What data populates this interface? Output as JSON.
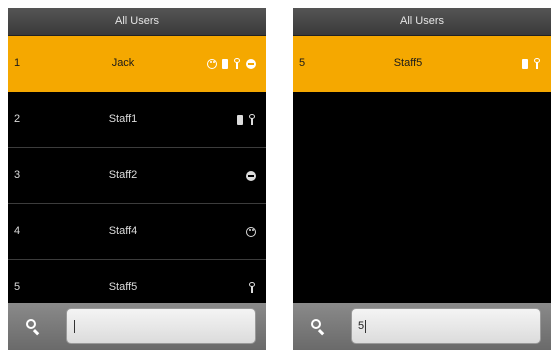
{
  "left": {
    "title": "All Users",
    "users": [
      {
        "num": "1",
        "name": "Jack",
        "icons": [
          "face",
          "card",
          "key",
          "password"
        ],
        "selected": true
      },
      {
        "num": "2",
        "name": "Staff1",
        "icons": [
          "card",
          "key"
        ],
        "selected": false
      },
      {
        "num": "3",
        "name": "Staff2",
        "icons": [
          "password"
        ],
        "selected": false
      },
      {
        "num": "4",
        "name": "Staff4",
        "icons": [
          "face"
        ],
        "selected": false
      },
      {
        "num": "5",
        "name": "Staff5",
        "icons": [
          "key"
        ],
        "selected": false
      }
    ],
    "search_value": ""
  },
  "right": {
    "title": "All Users",
    "users": [
      {
        "num": "5",
        "name": "Staff5",
        "icons": [
          "card",
          "key"
        ],
        "selected": true
      }
    ],
    "search_value": "5"
  },
  "colors": {
    "selected_row": "#f5a800",
    "background": "#000000"
  },
  "icon_names": {
    "face": "face-icon",
    "card": "card-icon",
    "key": "key-icon",
    "password": "password-icon"
  }
}
